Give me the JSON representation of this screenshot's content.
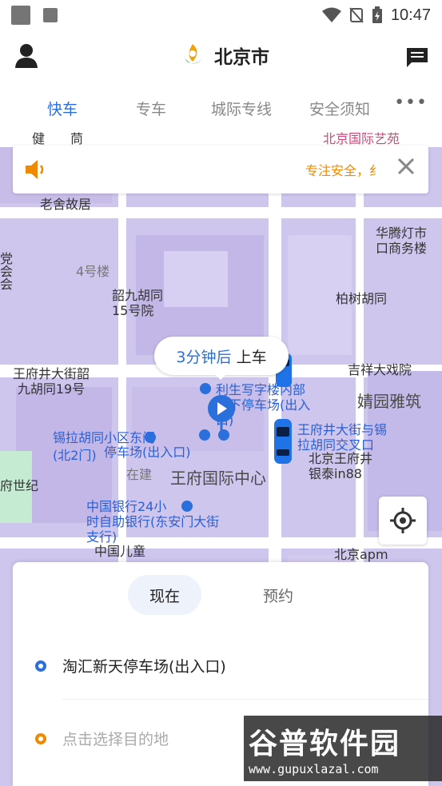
{
  "status_bar": {
    "time": "10:47"
  },
  "header": {
    "city": "北京市"
  },
  "tabs": [
    {
      "label": "快车",
      "active": true
    },
    {
      "label": "专车"
    },
    {
      "label": "城际专线"
    },
    {
      "label": "安全须知"
    }
  ],
  "notice": {
    "text": "专注安全，纟"
  },
  "map": {
    "pois": {
      "p1": "健",
      "p2": "茼",
      "p3": "北京国际艺苑",
      "p4": "老舍故居",
      "p5": "华腾灯市\n口商务楼",
      "p6": "4号楼",
      "p7": "韶九胡同\n15号院",
      "p8": "柏树胡同",
      "p9": "王府井大街韶\n九胡同19号",
      "p10": "吉祥大戏院",
      "p11": "婧园雅筑",
      "p12": "利生写字楼内部\n地下停车场(出入\n口)",
      "p13": "锡拉胡同小区东门",
      "p14": "(北2门)",
      "p15": "停车场(出入口)",
      "p16": "王府井大街与锡\n拉胡同交叉口",
      "p17": "北京王府井\n银泰in88",
      "p18": "在建",
      "p19": "王府国际中心",
      "p20": "中国银行24小\n时自助银行(东安门大街\n支行)",
      "p21": "中国儿童",
      "p22": "北京apm",
      "p23": "府世纪",
      "p24": "党\n会\n会"
    },
    "bubble": {
      "eta": "3分钟后",
      "action": "上车"
    }
  },
  "panel": {
    "mode_now": "现在",
    "mode_book": "预约",
    "from": "淘汇新天停车场(出入口)",
    "to_placeholder": "点击选择目的地"
  },
  "watermark": {
    "title": "谷普软件园",
    "url": "www.gupuxlazal.com"
  },
  "colors": {
    "accent": "#2a6fdb",
    "orange": "#f08a00",
    "map_bg": "#cfc6ee"
  }
}
